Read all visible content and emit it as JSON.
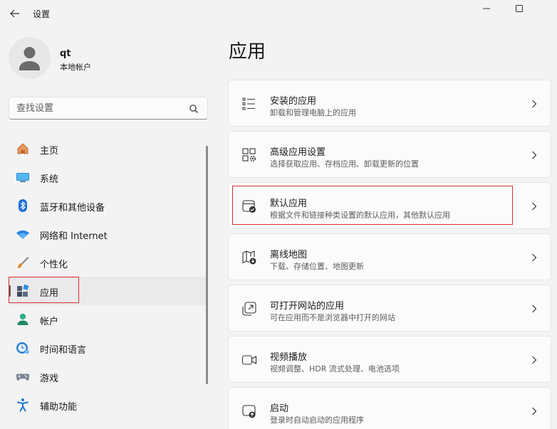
{
  "window": {
    "title": "设置"
  },
  "user": {
    "name": "qt",
    "account_type": "本地帐户"
  },
  "search": {
    "placeholder": "查找设置"
  },
  "sidebar": {
    "items": [
      {
        "label": "主页",
        "icon": "home-icon"
      },
      {
        "label": "系统",
        "icon": "monitor-icon"
      },
      {
        "label": "蓝牙和其他设备",
        "icon": "bluetooth-icon"
      },
      {
        "label": "网络和 Internet",
        "icon": "wifi-icon"
      },
      {
        "label": "个性化",
        "icon": "brush-icon"
      },
      {
        "label": "应用",
        "icon": "apps-icon",
        "selected": true
      },
      {
        "label": "帐户",
        "icon": "account-icon"
      },
      {
        "label": "时间和语言",
        "icon": "globe-clock-icon"
      },
      {
        "label": "游戏",
        "icon": "gamepad-icon"
      },
      {
        "label": "辅助功能",
        "icon": "accessibility-icon"
      }
    ]
  },
  "main": {
    "title": "应用",
    "cards": [
      {
        "title": "安装的应用",
        "desc": "卸载和管理电脑上的应用",
        "icon": "list-icon"
      },
      {
        "title": "高级应用设置",
        "desc": "选择获取应用、存档应用、卸载更新的位置",
        "icon": "app-settings-icon"
      },
      {
        "title": "默认应用",
        "desc": "根据文件和链接种类设置的默认应用，其他默认应用",
        "icon": "default-apps-icon",
        "highlighted": true
      },
      {
        "title": "离线地图",
        "desc": "下载、存储位置、地图更新",
        "icon": "offline-map-icon"
      },
      {
        "title": "可打开网站的应用",
        "desc": "可在应用而不是浏览器中打开的网站",
        "icon": "open-website-icon"
      },
      {
        "title": "视频播放",
        "desc": "视频调整、HDR 流式处理、电池选项",
        "icon": "video-icon"
      },
      {
        "title": "启动",
        "desc": "登录时自动启动的应用程序",
        "icon": "startup-icon"
      }
    ]
  },
  "colors": {
    "background": "#f3f3f3",
    "card": "#fbfbfb",
    "accent": "#0067c0",
    "highlight_box": "#d32f2f"
  }
}
